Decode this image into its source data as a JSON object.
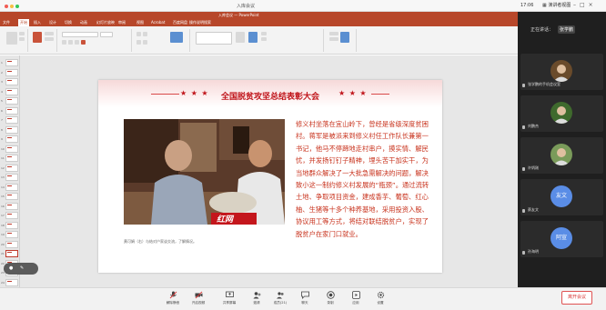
{
  "meeting": {
    "title": "入库会议",
    "time": "17:06",
    "view_label": "演讲者视图"
  },
  "powerpoint": {
    "title": "入库会议 — PowerPoint",
    "tabs": [
      "文件",
      "开始",
      "插入",
      "设计",
      "切换",
      "动画",
      "幻灯片放映",
      "审阅",
      "视图",
      "Acrobat",
      "百度网盘",
      "操作说明搜索"
    ],
    "active_tab_index": 1,
    "thumb_numbers": [
      "1",
      "2",
      "3",
      "4",
      "5",
      "6",
      "7",
      "8",
      "9",
      "10",
      "11",
      "12",
      "13",
      "14",
      "15",
      "16",
      "17",
      "18",
      "19",
      "20",
      "21",
      "22",
      "23",
      "24"
    ],
    "selected_thumb_index": 20
  },
  "slide": {
    "title": "全国脱贫攻坚总结表彰大会",
    "stars_left": "★ ★ ★",
    "stars_right": "★ ★ ★",
    "photo_watermark": "红网",
    "caption": "黄可娟（右）与结对户家谈交流，了解情况。",
    "text": "修义村坐落在宜山岭下，曾经是省级深度贫困村。蒋军是被派来到修义村任工作队长兼第一书记，他马不停蹄地走村串户，摸实情、解民忧，并发扬钉钉子精神，埋头苦干加实干，为当地群众解决了一大批急需解决的问题，解决致小这一制约修义村发展的“瓶颈”。通过流转土地、争取项目资金，建成香芋、葡萄、红心柚、生猪等十多个种养基地，采用投资入股、协议用工等方式，将结对联结脱贫户，实现了脱贫户在家门口就业。"
  },
  "annotation": {
    "left_icon": "mic-icon",
    "right_icon": "pen-icon"
  },
  "panel": {
    "speaking_label": "正在讲话：",
    "speaking_name": "张学鹏",
    "participants": [
      {
        "name": "张学鹏的手机会议室",
        "kind": "photo",
        "color": "#6a4b2b"
      },
      {
        "name": "刘鹏杰",
        "kind": "photo",
        "color": "#3f6a2d"
      },
      {
        "name": "许炳刚",
        "kind": "photo",
        "color": "#7a9b5a"
      },
      {
        "name": "蔡友文",
        "kind": "text",
        "avatar_text": "友文"
      },
      {
        "name": "孙海明",
        "kind": "text",
        "avatar_text": "阿宣"
      }
    ]
  },
  "toolbar": {
    "buttons": [
      {
        "label": "解除静音",
        "icon": "mic-off-icon"
      },
      {
        "label": "开启视频",
        "icon": "camera-off-icon"
      },
      {
        "label": "共享屏幕",
        "icon": "share-screen-icon"
      },
      {
        "label": "邀请",
        "icon": "invite-icon"
      },
      {
        "label": "成员(21)",
        "icon": "members-icon"
      },
      {
        "label": "聊天",
        "icon": "chat-icon"
      },
      {
        "label": "录制",
        "icon": "record-icon"
      },
      {
        "label": "应用",
        "icon": "apps-icon"
      },
      {
        "label": "设置",
        "icon": "settings-icon"
      }
    ],
    "leave_label": "离开会议"
  },
  "colors": {
    "ppt_brand": "#b7472a",
    "slide_red": "#c0151b",
    "text_red": "#c8321c",
    "leave_red": "#d93939",
    "panel_bg": "#1f1f1f"
  }
}
